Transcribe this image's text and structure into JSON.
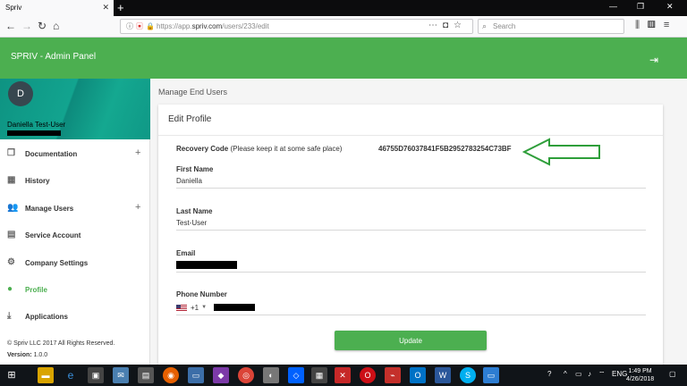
{
  "browser": {
    "tab_title": "Spriv",
    "url_scheme": "https://app.",
    "url_host": "spriv.com",
    "url_path": "/users/233/edit",
    "search_placeholder": "Search"
  },
  "app": {
    "title": "SPRIV - Admin Panel"
  },
  "user": {
    "initial": "D",
    "name": "Daniella Test-User"
  },
  "sidebar": {
    "items": [
      {
        "label": "Documentation",
        "icon": "copy-icon",
        "expandable": true
      },
      {
        "label": "History",
        "icon": "map-icon",
        "expandable": false
      },
      {
        "label": "Manage Users",
        "icon": "people-icon",
        "expandable": true
      },
      {
        "label": "Service Account",
        "icon": "account-box-icon",
        "expandable": false
      },
      {
        "label": "Company Settings",
        "icon": "gear-icon",
        "expandable": false
      },
      {
        "label": "Profile",
        "icon": "person-icon",
        "expandable": false,
        "active": true
      },
      {
        "label": "Applications",
        "icon": "download-icon",
        "expandable": false
      }
    ],
    "copyright": "© Spriv LLC 2017 All Rights Reserved.",
    "version_label": "Version:",
    "version": "1.0.0"
  },
  "main": {
    "breadcrumb": "Manage End Users",
    "card_title": "Edit Profile",
    "recovery_label": "Recovery Code",
    "recovery_hint": "(Please keep it at some safe place)",
    "recovery_code": "46755D76037841F5B2952783254C73BF",
    "fields": {
      "first_name": {
        "label": "First Name",
        "value": "Daniella"
      },
      "last_name": {
        "label": "Last Name",
        "value": "Test-User"
      },
      "email": {
        "label": "Email"
      },
      "phone": {
        "label": "Phone Number",
        "country_code": "+1"
      }
    },
    "update_label": "Update"
  },
  "taskbar": {
    "language": "ENG",
    "time": "1:49 PM",
    "date": "4/26/2018"
  },
  "colors": {
    "accent": "#4caf50",
    "arrow": "#2e9e3a"
  }
}
